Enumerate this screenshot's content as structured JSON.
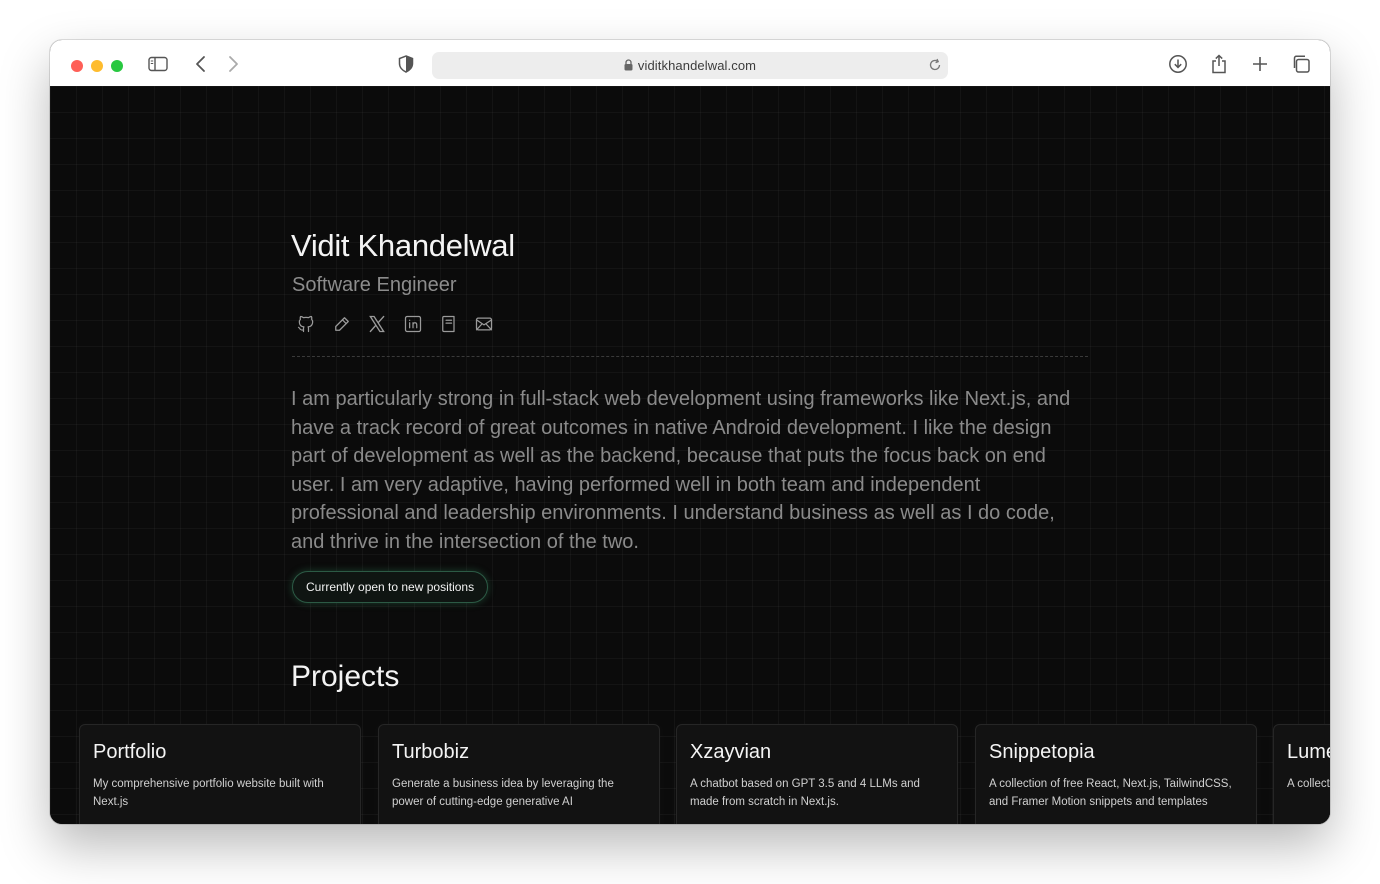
{
  "browser": {
    "url": "viditkhandelwal.com"
  },
  "profile": {
    "name": "Vidit Khandelwal",
    "title": "Software Engineer",
    "social_links": [
      "github-icon",
      "pen-icon",
      "x-icon",
      "linkedin-icon",
      "notebook-icon",
      "mail-icon"
    ],
    "bio": "I am particularly strong in full-stack web development using frameworks like Next.js, and have a track record of great outcomes in native Android development. I like the design part of development as well as the backend, because that puts the focus back on end user. I am very adaptive, having performed well in both team and independent professional and leadership environments. I understand business as well as I do code, and thrive in the intersection of the two.",
    "status_badge": "Currently open to new positions",
    "accent_color": "#2c5a45"
  },
  "projects": {
    "heading": "Projects",
    "items": [
      {
        "title": "Portfolio",
        "description": "My comprehensive portfolio website built with Next.js"
      },
      {
        "title": "Turbobiz",
        "description": "Generate a business idea by leveraging the power of cutting-edge generative AI"
      },
      {
        "title": "Xzayvian",
        "description": "A chatbot based on GPT 3.5 and 4 LLMs and made from scratch in Next.js."
      },
      {
        "title": "Snippetopia",
        "description": "A collection of free React, Next.js, TailwindCSS, and Framer Motion snippets and templates"
      },
      {
        "title": "Lume",
        "description": "A collection of free assets"
      }
    ]
  }
}
